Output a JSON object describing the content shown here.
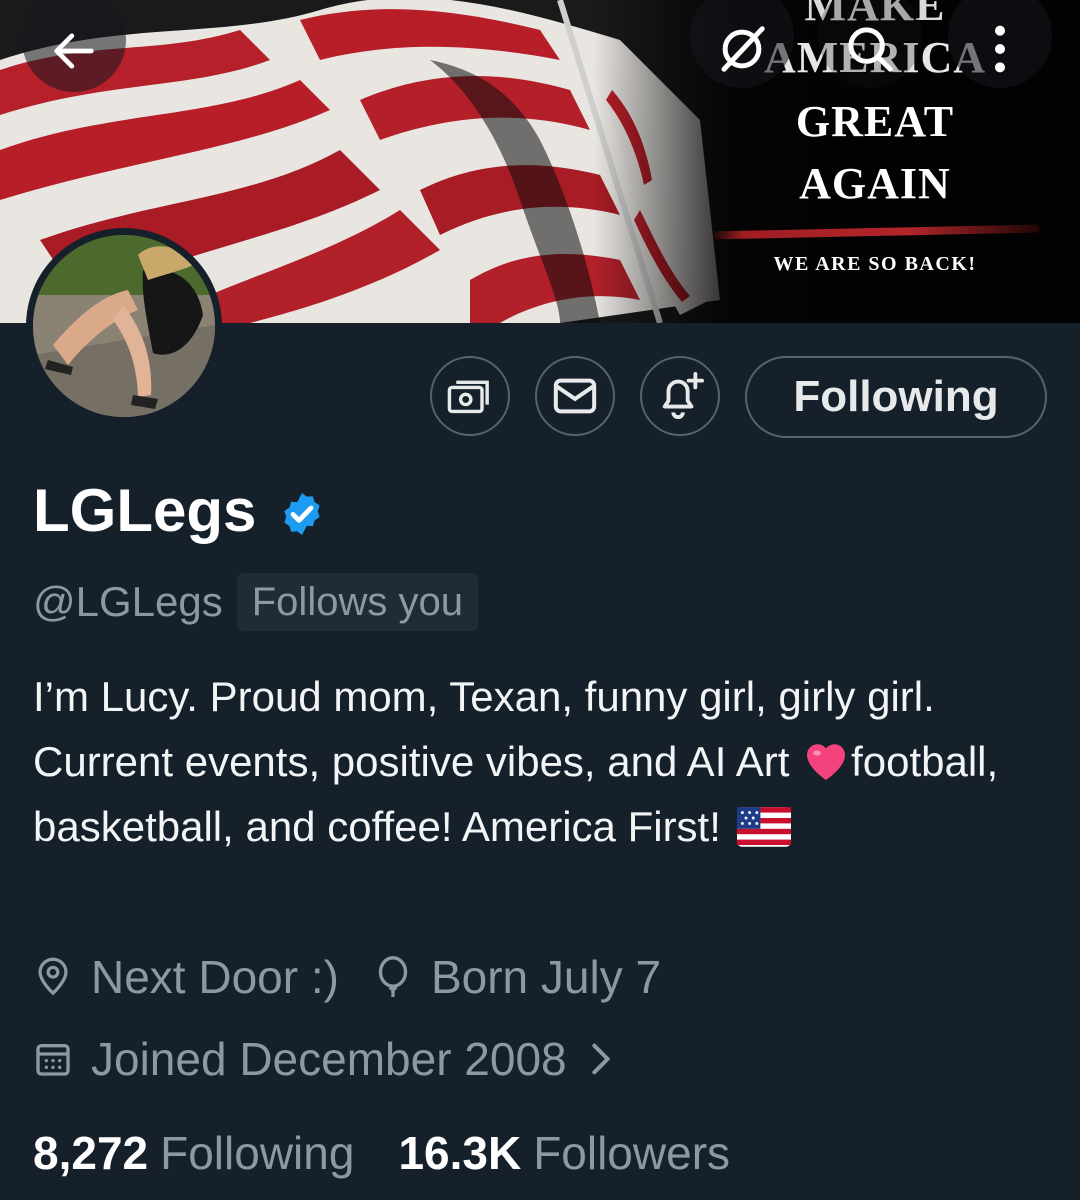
{
  "banner": {
    "line1": "MAKE",
    "line2": "AMERICA",
    "line3": "GREAT",
    "line4": "AGAIN",
    "tagline": "WE ARE SO BACK!"
  },
  "top_bar": {
    "back_icon": "arrow-left-icon",
    "hide_icon": "eye-slash-icon",
    "search_icon": "search-icon",
    "more_icon": "more-vertical-icon"
  },
  "actions": {
    "tip_icon": "money-icon",
    "message_icon": "envelope-icon",
    "notify_icon": "bell-plus-icon",
    "following_label": "Following"
  },
  "profile": {
    "display_name": "LGLegs",
    "verified_icon": "verified-badge-icon",
    "handle": "@LGLegs",
    "follows_you": "Follows you",
    "bio_part1": "I’m Lucy. Proud mom, Texan, funny girl, girly girl. Current events, positive vibes, and AI Art ",
    "bio_part2": "football, basketball, and coffee! America First! ",
    "location": "Next Door :)",
    "birthday": "Born July 7",
    "joined": "Joined December 2008"
  },
  "stats": {
    "following_count": "8,272",
    "following_label": "Following",
    "followers_count": "16.3K",
    "followers_label": "Followers"
  },
  "colors": {
    "background": "#15202b",
    "muted": "#8b98a5",
    "verified": "#1d9bf0",
    "border": "#536471"
  }
}
